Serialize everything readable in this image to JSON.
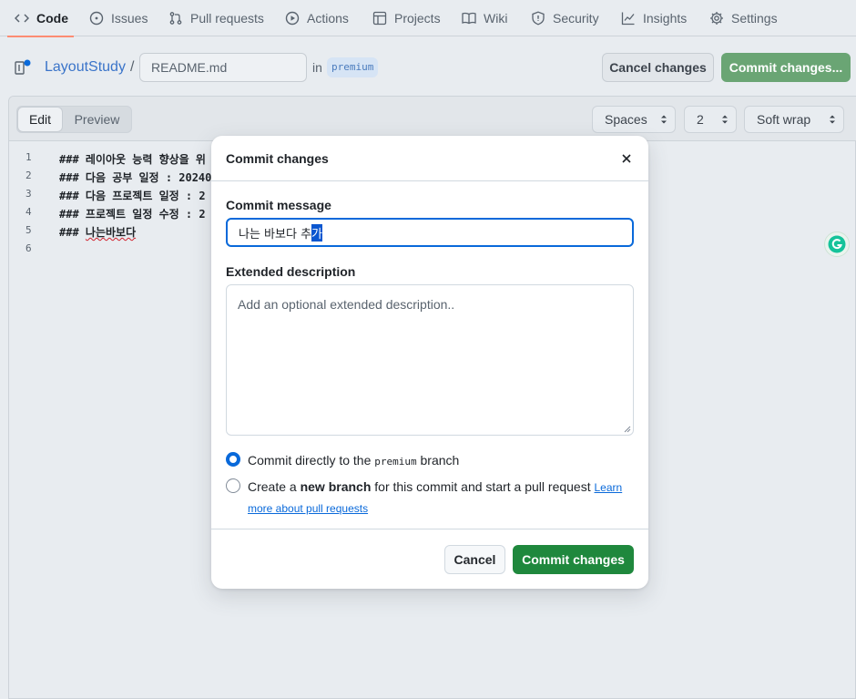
{
  "nav": {
    "tabs": [
      {
        "label": "Code",
        "icon": "code-icon"
      },
      {
        "label": "Issues",
        "icon": "issue-icon"
      },
      {
        "label": "Pull requests",
        "icon": "pull-request-icon"
      },
      {
        "label": "Actions",
        "icon": "play-icon"
      },
      {
        "label": "Projects",
        "icon": "table-icon"
      },
      {
        "label": "Wiki",
        "icon": "book-icon"
      },
      {
        "label": "Security",
        "icon": "shield-icon"
      },
      {
        "label": "Insights",
        "icon": "graph-icon"
      },
      {
        "label": "Settings",
        "icon": "gear-icon"
      }
    ],
    "active_tab": "Code"
  },
  "path": {
    "repo": "LayoutStudy",
    "separator": "/",
    "filename": "README.md",
    "in_text": "in",
    "branch": "premium"
  },
  "actions": {
    "cancel_label": "Cancel changes",
    "commit_label": "Commit changes..."
  },
  "editor": {
    "tabs": {
      "edit": "Edit",
      "preview": "Preview"
    },
    "indent_mode": "Spaces",
    "indent_size": "2",
    "wrap_mode": "Soft wrap",
    "lines": [
      {
        "num": "1",
        "text": "### 레이아웃 능력 향상을 위"
      },
      {
        "num": "2",
        "text": "### 다음 공부 일정 : 20240"
      },
      {
        "num": "3",
        "text": "### 다음 프로젝트 일정 : 2"
      },
      {
        "num": "4",
        "text": "### 프로젝트 일정 수정 : 2"
      },
      {
        "num": "5",
        "prefix": "### ",
        "squiggle": "나는바보다"
      },
      {
        "num": "6",
        "text": ""
      }
    ]
  },
  "modal": {
    "title": "Commit changes",
    "message_label": "Commit message",
    "message_value_plain": "나는 바보다 추",
    "message_value_selected": "가",
    "description_label": "Extended description",
    "description_placeholder": "Add an optional extended description..",
    "option_direct_pre": "Commit directly to the ",
    "option_direct_branch": "premium",
    "option_direct_post": " branch",
    "option_new_pre": "Create a ",
    "option_new_strong": "new branch",
    "option_new_post": " for this commit and start a pull request ",
    "option_new_link": "Learn more about pull requests",
    "cancel_label": "Cancel",
    "commit_label": "Commit changes"
  },
  "colors": {
    "accent": "#0969da",
    "commit_green": "#1f883d",
    "active_tab_underline": "#fd8c73"
  }
}
